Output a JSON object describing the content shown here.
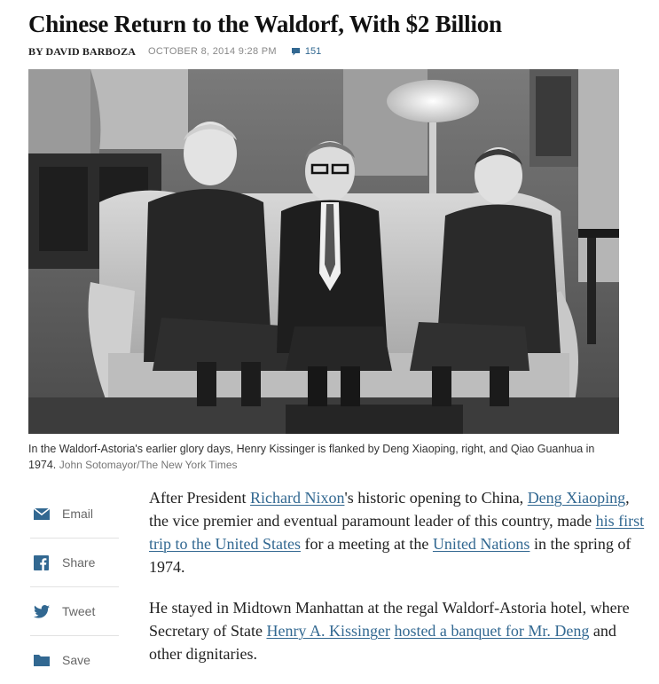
{
  "article": {
    "headline": "Chinese Return to the Waldorf, With $2 Billion",
    "byline": "BY DAVID BARBOZA",
    "dateline": "OCTOBER 8, 2014 9:28 PM",
    "comment_count": "151"
  },
  "photo": {
    "caption": "In the Waldorf-Astoria's earlier glory days, Henry Kissinger is flanked by Deng Xiaoping, right, and Qiao Guanhua in 1974.",
    "credit": "John Sotomayor/The New York Times"
  },
  "share": {
    "items": [
      {
        "label": "Email",
        "icon": "envelope-icon"
      },
      {
        "label": "Share",
        "icon": "facebook-icon"
      },
      {
        "label": "Tweet",
        "icon": "twitter-icon"
      },
      {
        "label": "Save",
        "icon": "folder-icon"
      }
    ]
  },
  "body": {
    "p1": {
      "t1": "After President ",
      "link1": "Richard Nixon",
      "t2": "'s historic opening to China, ",
      "link2": "Deng Xiaoping",
      "t3": ", the vice premier and eventual paramount leader of this country, made ",
      "link3": "his first trip to the United States",
      "t4": " for a meeting at the ",
      "link4": "United Nations",
      "t5": " in the spring of 1974."
    },
    "p2": {
      "t1": "He stayed in Midtown Manhattan at the regal Waldorf-Astoria hotel, where Secretary of State ",
      "link1": "Henry A. Kissinger",
      "t2": " ",
      "link2": "hosted a banquet for Mr. Deng",
      "t3": " and other dignitaries."
    }
  },
  "colors": {
    "link": "#326891",
    "share_icon": "#326891",
    "meta_gray": "#888888"
  }
}
